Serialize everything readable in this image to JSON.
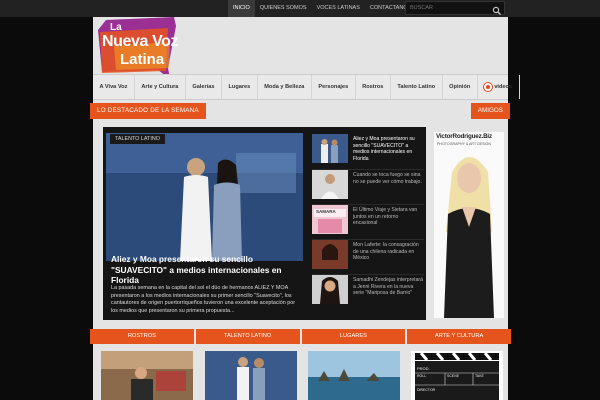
{
  "topnav": {
    "items": [
      {
        "label": "INICIO",
        "active": true
      },
      {
        "label": "QUIENES SOMOS",
        "active": false
      },
      {
        "label": "VOCES LATINAS",
        "active": false
      },
      {
        "label": "CONTACTANOS",
        "active": false
      }
    ]
  },
  "search": {
    "placeholder": "BUSCAR",
    "icon": "search-icon"
  },
  "logo": {
    "line1": "La",
    "line2": "Nueva Voz",
    "line3": "Latina"
  },
  "mainnav": {
    "items": [
      "A Viva Voz",
      "Arte y Cultura",
      "Galerías",
      "Lugares",
      "Moda y Belleza",
      "Personajes",
      "Rostros",
      "Talento Latino",
      "Opinión"
    ],
    "videos_label": "videos",
    "videos_icon": "videos-icon"
  },
  "sections": {
    "destacado": "LO DESTACADO DE LA SEMANA",
    "amigos": "AMIGOS"
  },
  "featured": {
    "category": "TALENTO LATINO",
    "title": "Aliez y Moa presentaron su sencillo \"SUAVECITO\" a medios internacionales en Florida",
    "excerpt": "La pasada semana en la capital del sol el dúo de hermanos ALIEZ Y MOA presentaron a los medios internacionales su primer sencillo \"Suavecito\", los cantautores de origen puertorriqueños tuvieron una excelente aceptación por los medios que presentaron su primera propuesta..."
  },
  "side_list": [
    {
      "text": "Aliez y Moa presentaron su sencillo \"SUAVECITO\" a medios internacionales en Florida",
      "active": true
    },
    {
      "text": "Cuando se toca fuego se sina no se puede ver cómo trabajo.",
      "active": false
    },
    {
      "text": "El Último Viaje y Sietara van juntos en un retorno encasional",
      "active": false,
      "thumb_text": "SAMARA"
    },
    {
      "text": "Mon Laferte: la consagración de una chilena radicada en México",
      "active": false
    },
    {
      "text": "Samadhi Zendejas interpretará a Jenni Rivera en la nueva serie \"Mariposa de Barrio\"",
      "active": false
    }
  ],
  "ad": {
    "brand": "VictorRodriguez.Biz",
    "subtitle": "PHOTOGRAPHY & ART DESIGN"
  },
  "categories": [
    "ROSTROS",
    "TALENTO LATINO",
    "LUGARES",
    "ARTE Y CULTURA"
  ],
  "clapper": {
    "prod": "PROD.",
    "roll": "ROLL",
    "scene": "SCENE",
    "take": "TAKE",
    "director": "DIRECTOR"
  },
  "colors": {
    "accent": "#e6541d",
    "dark": "#151515",
    "page_bg": "#e4e4e4"
  }
}
